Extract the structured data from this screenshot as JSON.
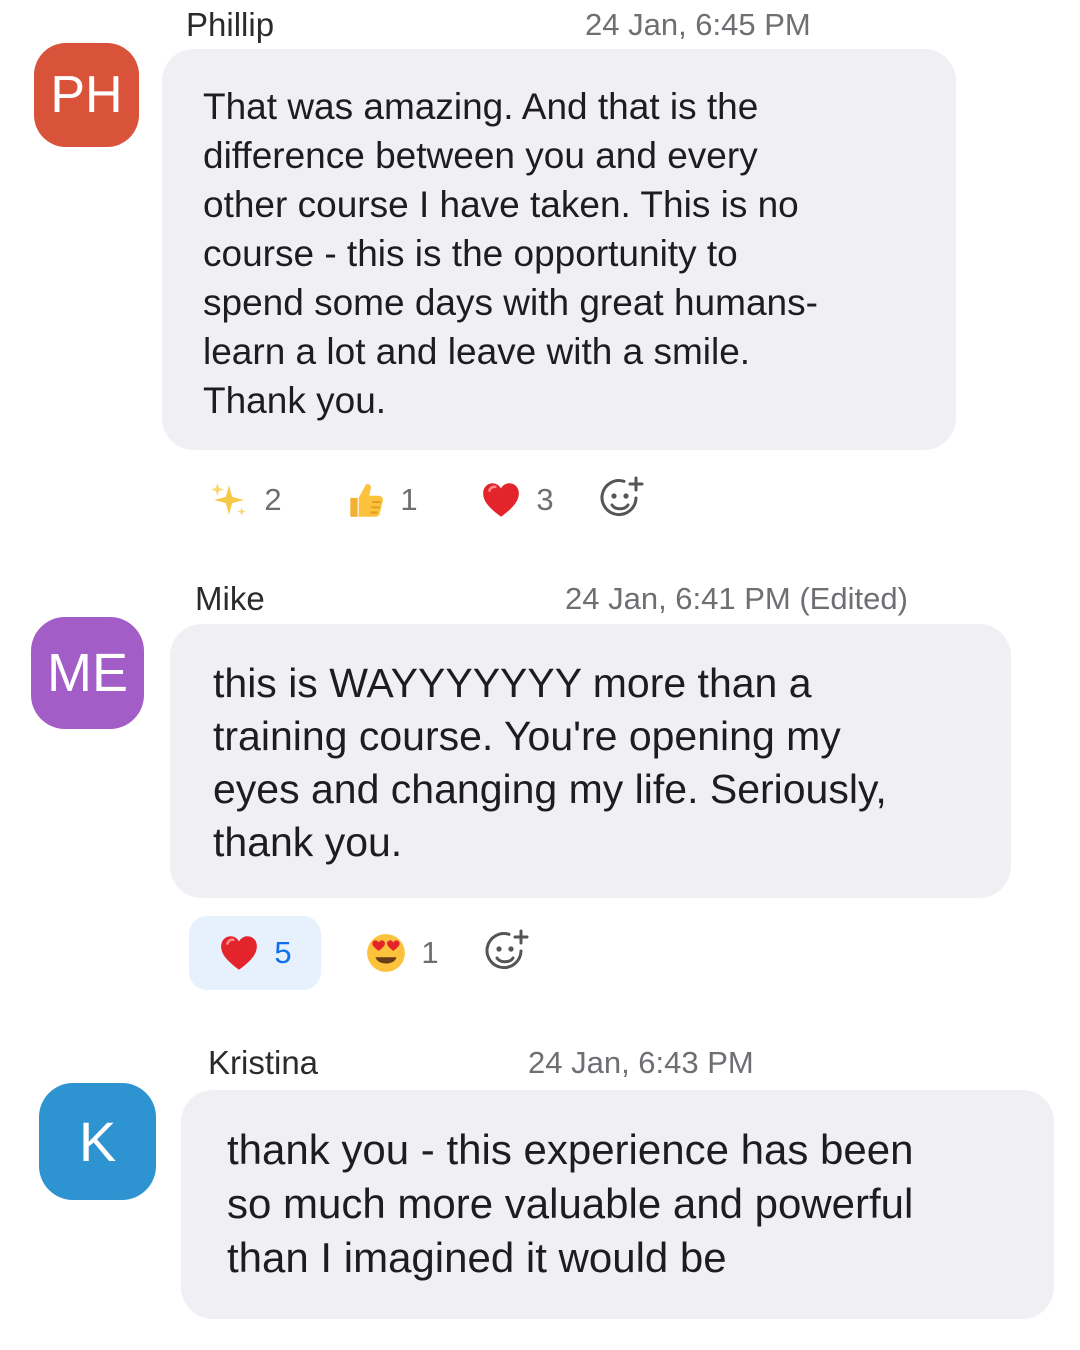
{
  "messages": [
    {
      "initials": "PH",
      "name": "Phillip",
      "time": "24 Jan, 6:45 PM",
      "text": "That was amazing. And that is the\ndifference between you and every\nother course I have taken. This is no\ncourse - this is the opportunity to\nspend some days with great humans-\nlearn a lot and leave with a smile.\nThank you.",
      "avatar_color": "#d9523a",
      "reactions": [
        {
          "icon": "sparkles-icon",
          "count": "2",
          "active": false
        },
        {
          "icon": "thumbs-up-icon",
          "count": "1",
          "active": false
        },
        {
          "icon": "red-heart-icon",
          "count": "3",
          "active": false
        }
      ]
    },
    {
      "initials": "ME",
      "name": "Mike",
      "time": "24 Jan, 6:41 PM (Edited)",
      "text": "this is WAYYYYYYY more than a\ntraining course.  You're opening my\neyes and changing my life. Seriously,\nthank you.",
      "avatar_color": "#a35dc7",
      "reactions": [
        {
          "icon": "red-heart-icon",
          "count": "5",
          "active": true
        },
        {
          "icon": "heart-eyes-icon",
          "count": "1",
          "active": false
        }
      ]
    },
    {
      "initials": "K",
      "name": "Kristina",
      "time": "24 Jan, 6:43 PM",
      "text": "thank you - this experience has been\nso much more valuable and powerful\nthan I imagined it would be",
      "avatar_color": "#2e93d1",
      "reactions": []
    }
  ],
  "colors": {
    "bubble": "#f0f0f4",
    "active_reaction_bg": "#e6f1fd",
    "active_reaction_count": "#0e71eb",
    "timestamp": "#6e6e73"
  }
}
